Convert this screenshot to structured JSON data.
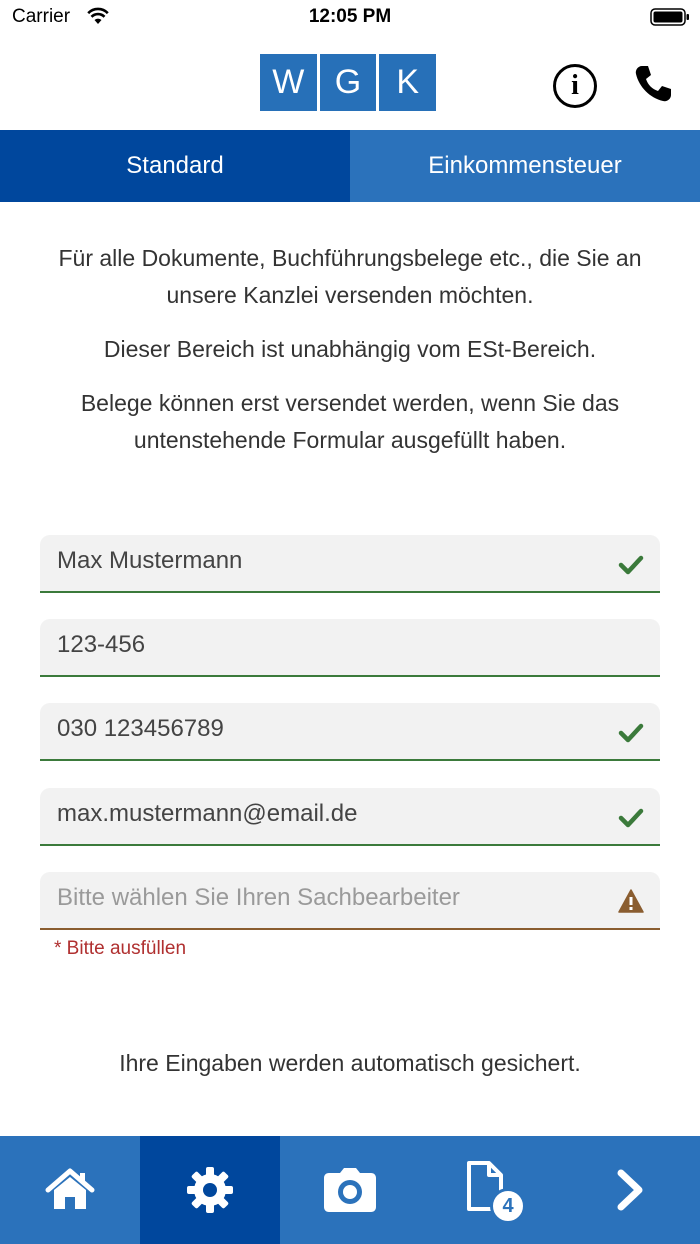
{
  "status_bar": {
    "carrier": "Carrier",
    "time": "12:05 PM"
  },
  "header": {
    "logo_letters": [
      "W",
      "G",
      "K"
    ],
    "info_label": "i"
  },
  "tabs": [
    {
      "label": "Standard",
      "active": true
    },
    {
      "label": "Einkommensteuer",
      "active": false
    }
  ],
  "intro": {
    "p1": "Für alle Dokumente, Buchführungsbelege etc., die Sie an unsere Kanzlei versenden möchten.",
    "p2": "Dieser Bereich ist unabhängig vom ESt-Bereich.",
    "p3": "Belege können erst versendet werden, wenn Sie das untenstehende Formular ausgefüllt haben."
  },
  "form": {
    "name": {
      "value": "Max Mustermann",
      "status": "check-icon"
    },
    "client_number": {
      "value": "123-456"
    },
    "phone": {
      "value": "030 123456789",
      "status": "check-icon"
    },
    "email": {
      "value": "max.mustermann@email.de",
      "status": "check-icon"
    },
    "clerk": {
      "placeholder": "Bitte wählen Sie Ihren Sachbearbeiter",
      "status": "warning-icon",
      "error": "* Bitte ausfüllen"
    }
  },
  "autosave_text": "Ihre Eingaben werden automatisch gesichert.",
  "bottom_nav": {
    "items": [
      "home-icon",
      "settings-icon",
      "camera-icon",
      "document-icon",
      "next-icon"
    ],
    "document_badge": "4"
  },
  "colors": {
    "brand": "#2770b8",
    "tab_active": "#00479d",
    "tab_inactive": "#2b72bb",
    "valid": "#3b7a3b",
    "warning": "#8a5d30",
    "error": "#b03030"
  }
}
